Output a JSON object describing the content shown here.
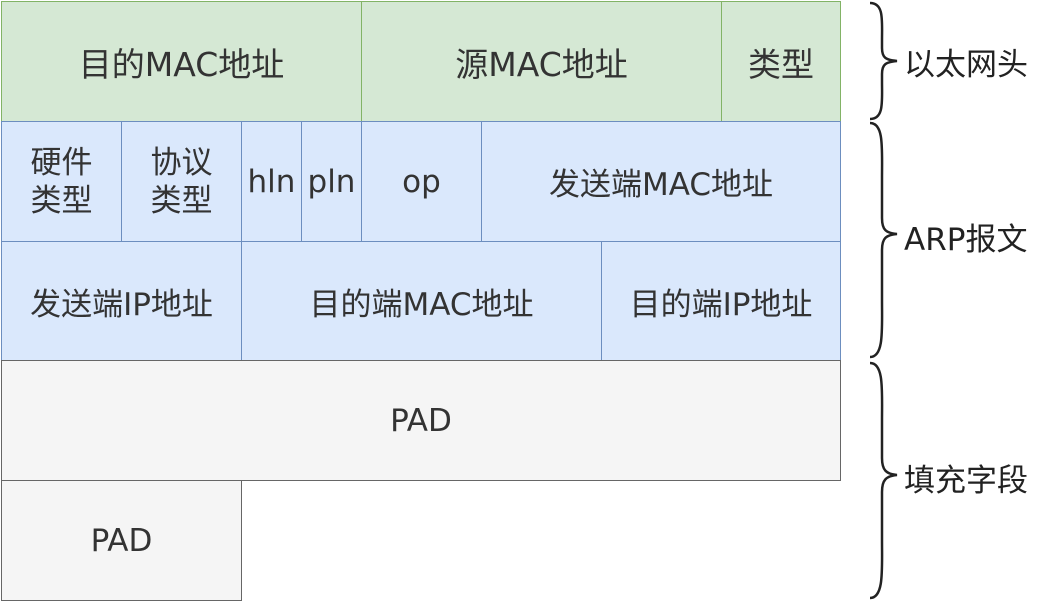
{
  "ethernet_header": {
    "dest_mac": "目的MAC地址",
    "src_mac": "源MAC地址",
    "type": "类型"
  },
  "arp_packet": {
    "hardware_type": "硬件\n类型",
    "protocol_type": "协议\n类型",
    "hln": "hln",
    "pln": "pln",
    "op": "op",
    "sender_mac": "发送端MAC地址",
    "sender_ip": "发送端IP地址",
    "target_mac": "目的端MAC地址",
    "target_ip": "目的端IP地址"
  },
  "padding": {
    "pad_row1": "PAD",
    "pad_row2": "PAD"
  },
  "labels": {
    "ethernet_header": "以太网头",
    "arp_packet": "ARP报文",
    "padding": "填充字段"
  },
  "colors": {
    "ethernet_fill": "#d5e8d4",
    "ethernet_stroke": "#82b366",
    "arp_fill": "#dae8fc",
    "arp_stroke": "#6c8ebf",
    "pad_fill": "#f5f5f5",
    "pad_stroke": "#666666"
  }
}
